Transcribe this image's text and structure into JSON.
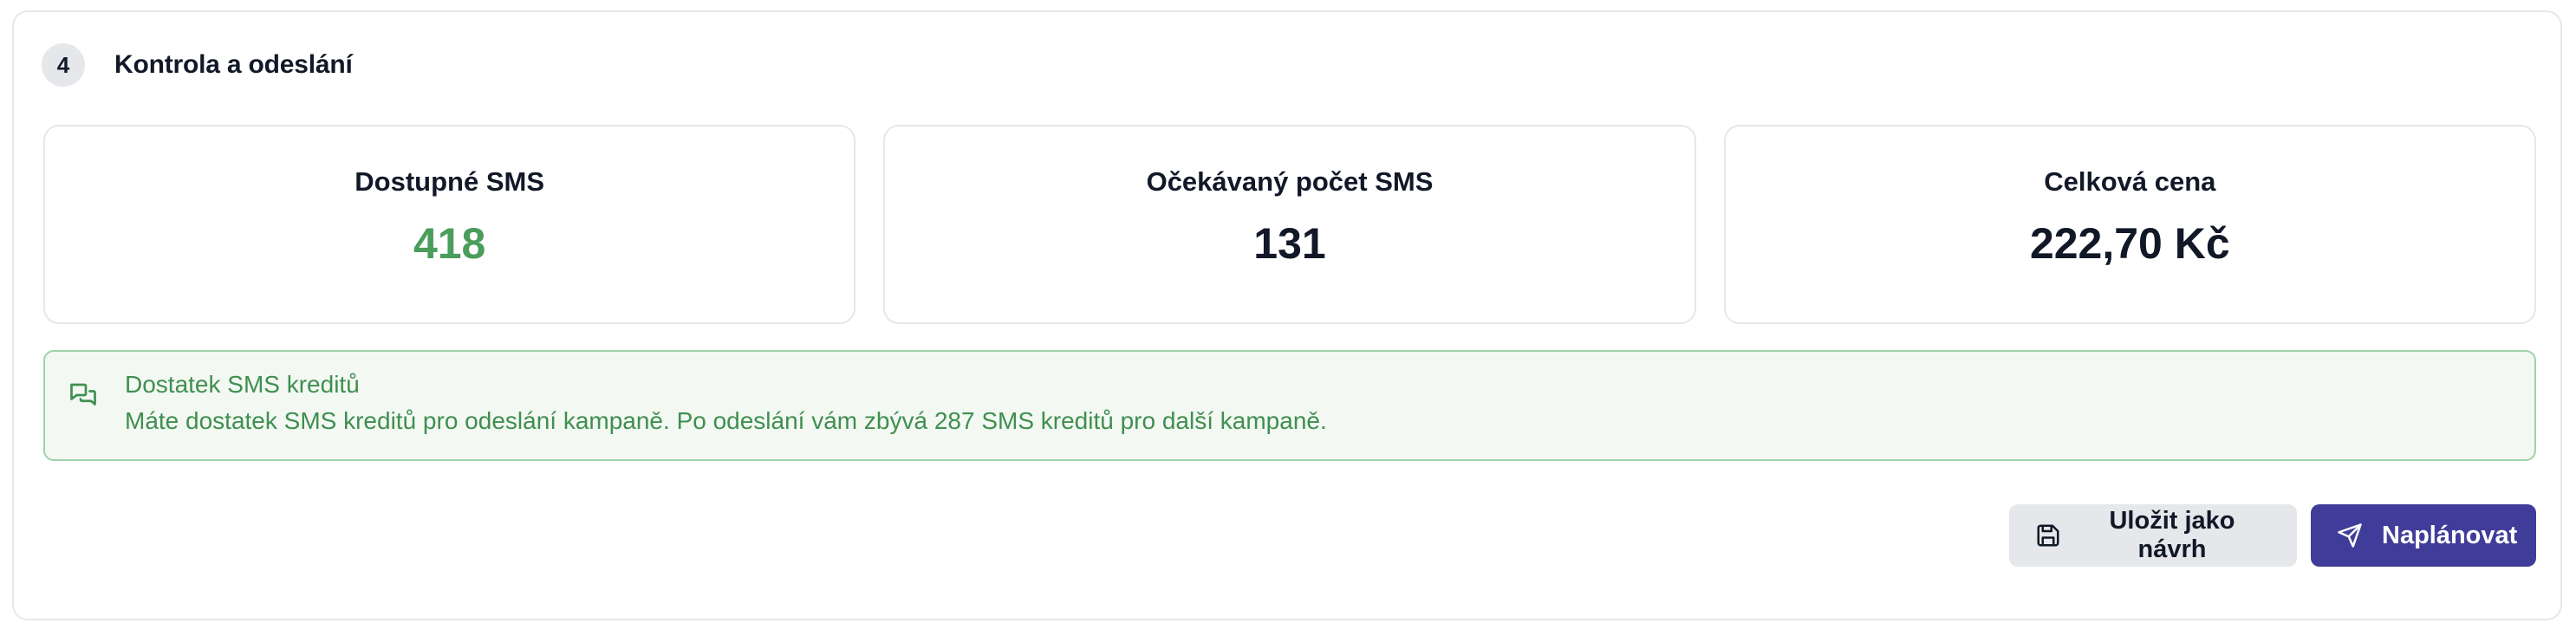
{
  "step": {
    "number": "4",
    "title": "Kontrola a odeslání"
  },
  "stats": [
    {
      "label": "Dostupné SMS",
      "value": "418"
    },
    {
      "label": "Očekávaný počet SMS",
      "value": "131"
    },
    {
      "label": "Celková cena",
      "value": "222,70 Kč"
    }
  ],
  "alert": {
    "icon": "chat-bubbles-icon",
    "title": "Dostatek SMS kreditů",
    "message": "Máte dostatek SMS kreditů pro odeslání kampaně. Po odeslání vám zbývá 287 SMS kreditů pro další kampaně."
  },
  "actions": {
    "save_draft_label": "Uložit jako návrh",
    "save_draft_icon": "floppy-disk-icon",
    "schedule_label": "Naplánovat",
    "schedule_icon": "paper-plane-icon"
  },
  "colors": {
    "accent": "#3f3d99",
    "success": "#4a9d5b",
    "success_bg": "#f3f8f3",
    "success_border": "#9fd3a8"
  }
}
